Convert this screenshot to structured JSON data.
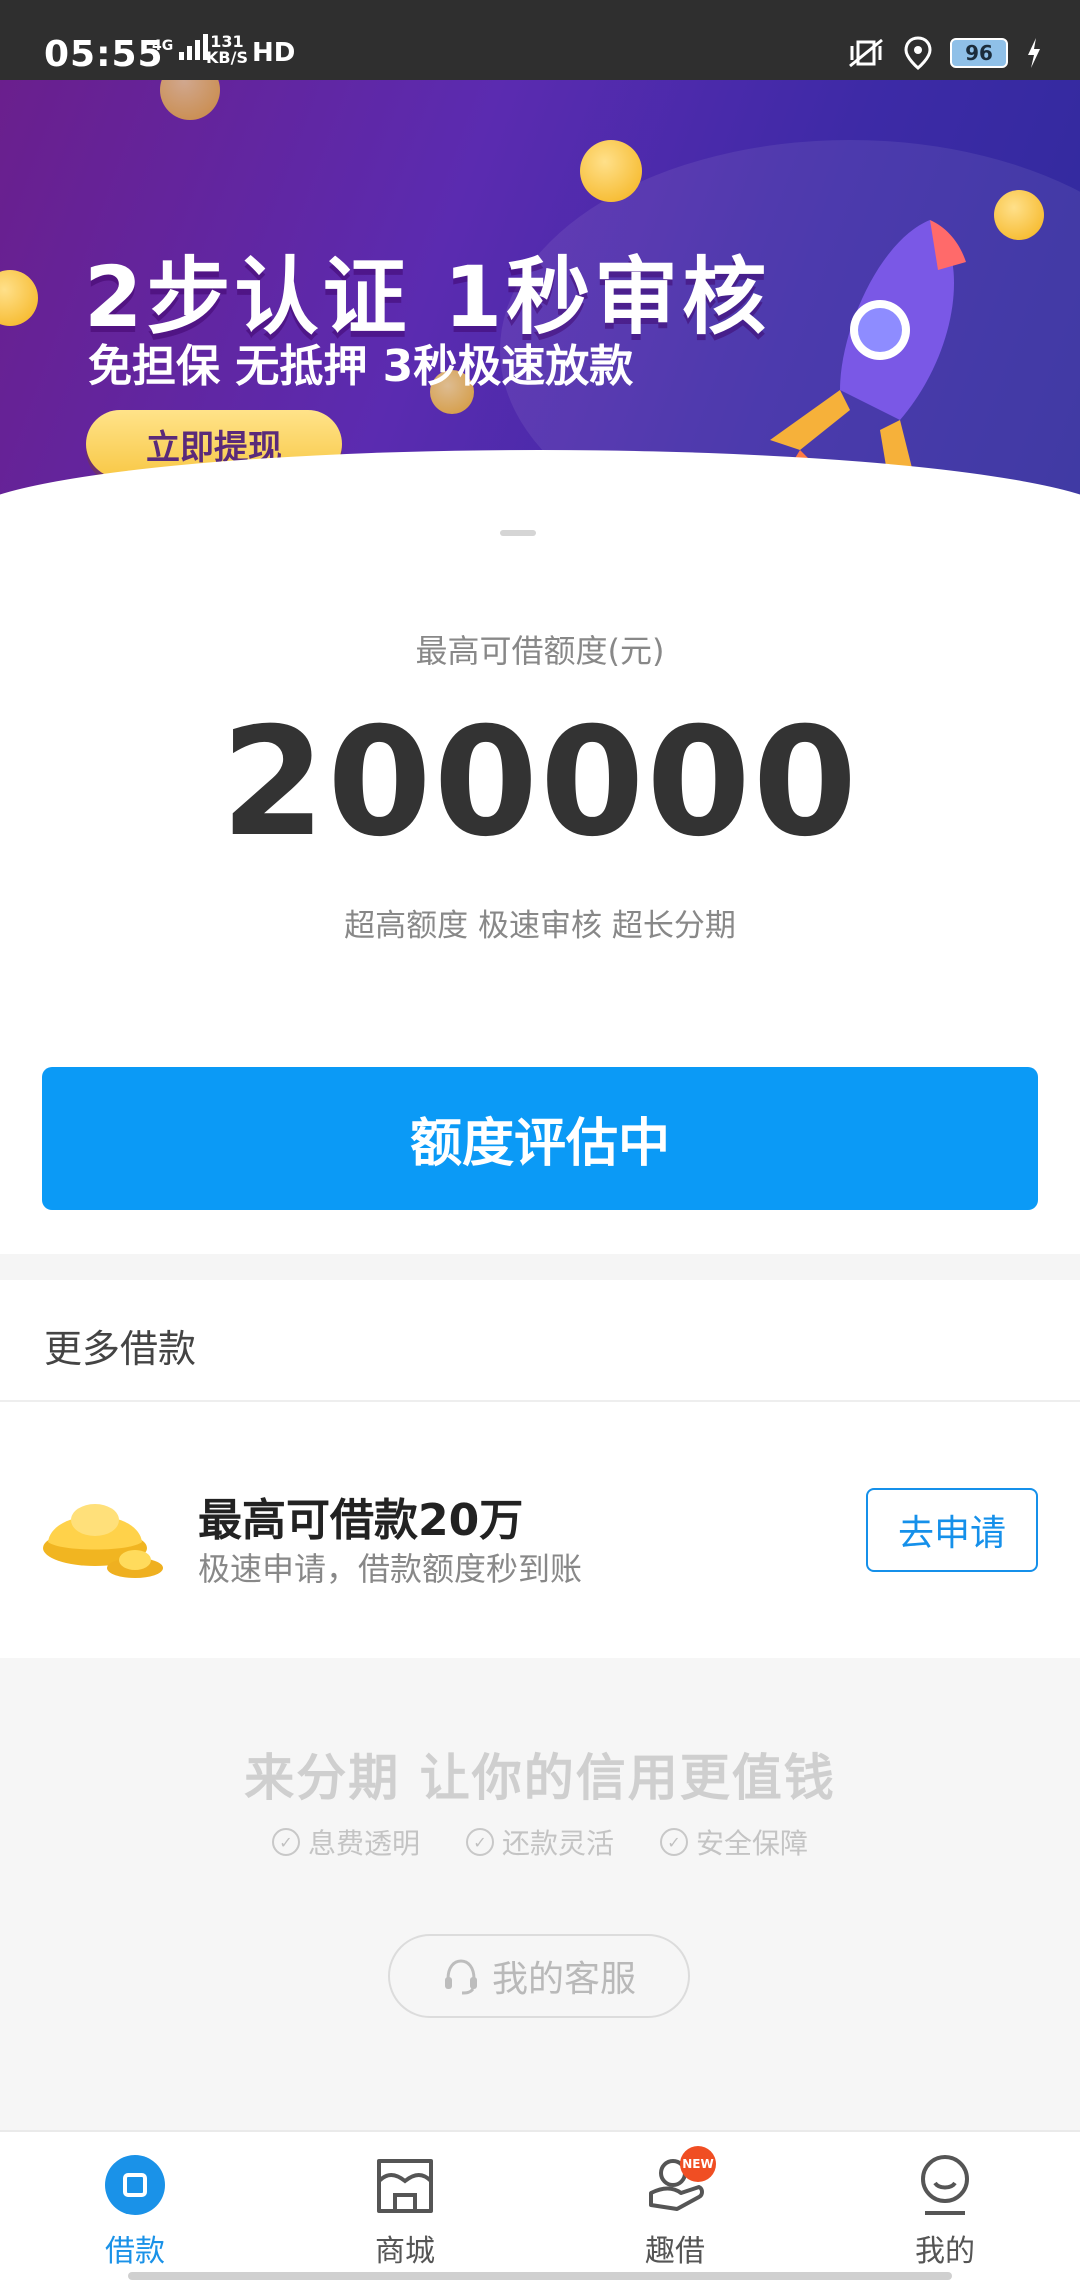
{
  "status_bar": {
    "time": "05:55",
    "network": "4G",
    "speed_top": "131",
    "speed_bottom": "KB/S",
    "hd": "HD",
    "battery": "96"
  },
  "banner": {
    "title": "2步认证 1秒审核",
    "subtitle": "免担保 无抵押 3秒极速放款",
    "cta_label": "立即提现"
  },
  "quota": {
    "label": "最高可借额度(元)",
    "value": "200000",
    "tags": "超高额度 极速审核 超长分期"
  },
  "evaluate_button": "额度评估中",
  "more_loans": {
    "title": "更多借款",
    "items": [
      {
        "title": "最高可借款20万",
        "desc": "极速申请，借款额度秒到账",
        "button": "去申请"
      }
    ]
  },
  "footer": {
    "slogan": "来分期 让你的信用更值钱",
    "features": [
      "息费透明",
      "还款灵活",
      "安全保障"
    ],
    "service_button": "我的客服"
  },
  "nav": {
    "items": [
      {
        "label": "借款",
        "icon": "loan-icon"
      },
      {
        "label": "商城",
        "icon": "store-icon"
      },
      {
        "label": "趣借",
        "icon": "fun-borrow-icon",
        "badge": "NEW"
      },
      {
        "label": "我的",
        "icon": "profile-icon"
      }
    ],
    "active_color": "#1a92e8"
  },
  "colors": {
    "primary": "#0b9af6",
    "banner_purple": "#5b2bb0"
  }
}
